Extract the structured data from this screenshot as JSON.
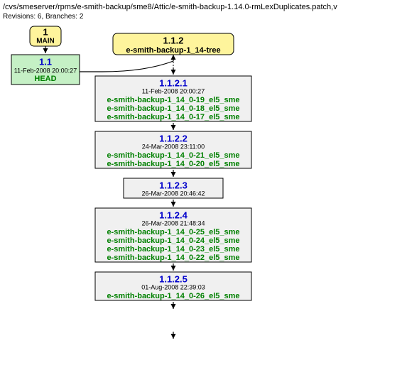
{
  "header": {
    "path": "/cvs/smeserver/rpms/e-smith-backup/sme8/Attic/e-smith-backup-1.14.0-rmLexDuplicates.patch,v",
    "revisions_label": "Revisions: 6, Branches: 2"
  },
  "main_node": {
    "number": "1",
    "label": "MAIN"
  },
  "rev_1_1": {
    "version": "1.1",
    "date": "11-Feb-2008 20:00:27",
    "head": "HEAD"
  },
  "branch_1_1_2": {
    "version": "1.1.2",
    "name": "e-smith-backup-1_14-tree"
  },
  "rev_1_1_2_1": {
    "version": "1.1.2.1",
    "date": "11-Feb-2008 20:00:27",
    "tags": [
      "e-smith-backup-1_14_0-19_el5_sme",
      "e-smith-backup-1_14_0-18_el5_sme",
      "e-smith-backup-1_14_0-17_el5_sme"
    ]
  },
  "rev_1_1_2_2": {
    "version": "1.1.2.2",
    "date": "24-Mar-2008 23:11:00",
    "tags": [
      "e-smith-backup-1_14_0-21_el5_sme",
      "e-smith-backup-1_14_0-20_el5_sme"
    ]
  },
  "rev_1_1_2_3": {
    "version": "1.1.2.3",
    "date": "26-Mar-2008 20:46:42"
  },
  "rev_1_1_2_4": {
    "version": "1.1.2.4",
    "date": "26-Mar-2008 21:48:34",
    "tags": [
      "e-smith-backup-1_14_0-25_el5_sme",
      "e-smith-backup-1_14_0-24_el5_sme",
      "e-smith-backup-1_14_0-23_el5_sme",
      "e-smith-backup-1_14_0-22_el5_sme"
    ]
  },
  "rev_1_1_2_5": {
    "version": "1.1.2.5",
    "date": "01-Aug-2008 22:39:03",
    "tags": [
      "e-smith-backup-1_14_0-26_el5_sme"
    ]
  },
  "chart_data": {
    "type": "tree",
    "root": "MAIN",
    "nodes": [
      "1.1",
      "1.1.2",
      "1.1.2.1",
      "1.1.2.2",
      "1.1.2.3",
      "1.1.2.4",
      "1.1.2.5"
    ],
    "edges": [
      [
        "MAIN",
        "1.1"
      ],
      [
        "1.1",
        "1.1.2"
      ],
      [
        "1.1.2",
        "1.1.2.1"
      ],
      [
        "1.1.2.1",
        "1.1.2.2"
      ],
      [
        "1.1.2.2",
        "1.1.2.3"
      ],
      [
        "1.1.2.3",
        "1.1.2.4"
      ],
      [
        "1.1.2.4",
        "1.1.2.5"
      ]
    ]
  }
}
